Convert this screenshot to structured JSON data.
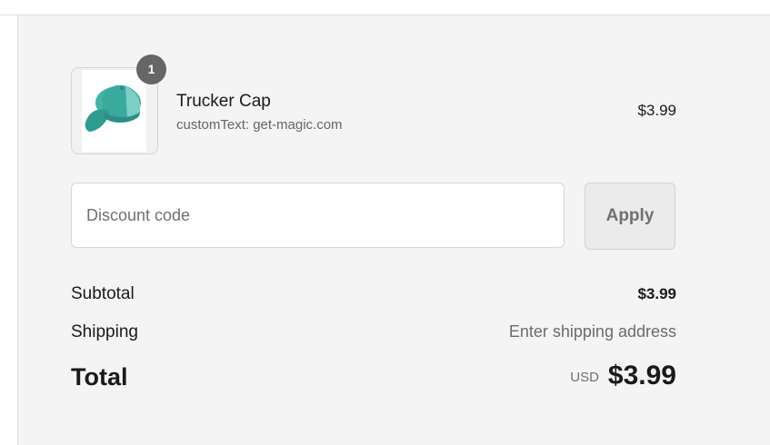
{
  "line_item": {
    "quantity": "1",
    "name": "Trucker Cap",
    "variant": "customText: get-magic.com",
    "price": "$3.99",
    "image_icon": "trucker-cap-image"
  },
  "discount": {
    "placeholder": "Discount code",
    "value": "",
    "apply_label": "Apply"
  },
  "totals": {
    "subtotal_label": "Subtotal",
    "subtotal_value": "$3.99",
    "shipping_label": "Shipping",
    "shipping_value": "Enter shipping address",
    "total_label": "Total",
    "currency": "USD",
    "total_value": "$3.99"
  },
  "colors": {
    "panel_background": "#f4f4f4",
    "badge_background": "#666666",
    "cap_teal": "#3fb3a8"
  }
}
